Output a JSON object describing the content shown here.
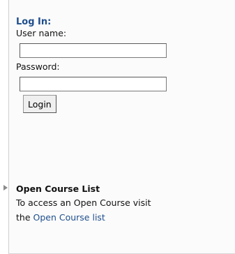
{
  "login": {
    "title": "Log In:",
    "username_label": "User name:",
    "username_value": "",
    "password_label": "Password:",
    "password_value": "",
    "login_button": "Login"
  },
  "open_course": {
    "title": "Open Course List",
    "text_line1": "To access an Open Course visit",
    "text_prefix": "the",
    "link_text": "Open Course list"
  },
  "colors": {
    "heading_blue": "#1f4e8c",
    "link_blue": "#1f4e8c",
    "panel_background": "#fbfbfb"
  }
}
